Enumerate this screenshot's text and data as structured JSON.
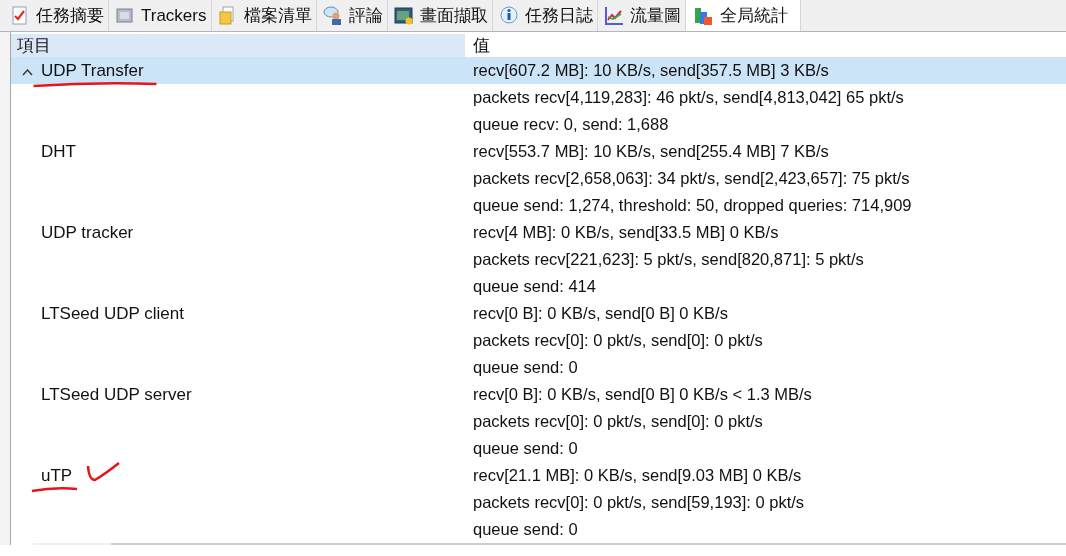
{
  "tabs": [
    {
      "label": "任務摘要",
      "selected": false
    },
    {
      "label": "Trackers",
      "selected": false
    },
    {
      "label": "檔案清單",
      "selected": false
    },
    {
      "label": "評論",
      "selected": false
    },
    {
      "label": "畫面擷取",
      "selected": false
    },
    {
      "label": "任務日誌",
      "selected": false
    },
    {
      "label": "流量圖",
      "selected": false
    },
    {
      "label": "全局統計",
      "selected": true
    }
  ],
  "table": {
    "columns": [
      "項目",
      "值"
    ],
    "groups": [
      {
        "name": "UDP Transfer",
        "selected": true,
        "underlined": true,
        "check_marked": false,
        "lines": [
          "recv[607.2 MB]: 10 KB/s, send[357.5 MB] 3 KB/s",
          "packets recv[4,119,283]: 46 pkt/s, send[4,813,042] 65 pkt/s",
          "queue recv: 0, send: 1,688"
        ]
      },
      {
        "name": "DHT",
        "selected": false,
        "underlined": false,
        "check_marked": false,
        "lines": [
          "recv[553.7 MB]: 10 KB/s, send[255.4 MB] 7 KB/s",
          "packets recv[2,658,063]: 34 pkt/s, send[2,423,657]: 75 pkt/s",
          "queue send: 1,274, threshold: 50, dropped queries: 714,909"
        ]
      },
      {
        "name": "UDP tracker",
        "selected": false,
        "underlined": false,
        "check_marked": false,
        "lines": [
          "recv[4 MB]: 0 KB/s, send[33.5 MB] 0 KB/s",
          "packets recv[221,623]: 5 pkt/s, send[820,871]: 5 pkt/s",
          "queue send: 414"
        ]
      },
      {
        "name": "LTSeed UDP client",
        "selected": false,
        "underlined": false,
        "check_marked": false,
        "lines": [
          "recv[0 B]: 0 KB/s, send[0 B] 0 KB/s",
          "packets recv[0]: 0 pkt/s, send[0]: 0 pkt/s",
          "queue send: 0"
        ]
      },
      {
        "name": "LTSeed UDP server",
        "selected": false,
        "underlined": false,
        "check_marked": false,
        "lines": [
          "recv[0 B]: 0 KB/s, send[0 B] 0 KB/s < 1.3 MB/s",
          "packets recv[0]: 0 pkt/s, send[0]: 0 pkt/s",
          "queue send: 0"
        ]
      },
      {
        "name": "uTP",
        "selected": false,
        "underlined": true,
        "check_marked": true,
        "lines": [
          "recv[21.1 MB]: 0 KB/s, send[9.03 MB] 0 KB/s",
          "packets recv[0]: 0 pkt/s, send[59,193]: 0 pkt/s",
          "queue send: 0"
        ]
      }
    ]
  }
}
